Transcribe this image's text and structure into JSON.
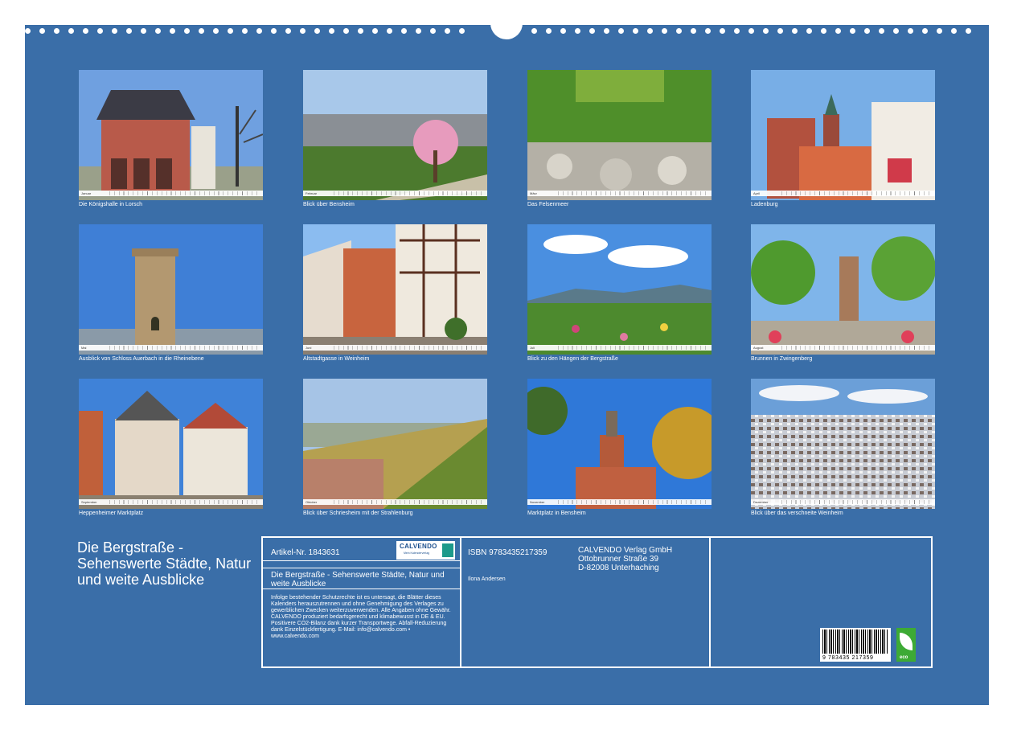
{
  "months": [
    {
      "month": "Januar",
      "caption": "Die Königshalle in Lorsch",
      "scene": "royal-hall-photo"
    },
    {
      "month": "Februar",
      "caption": "Blick über Bensheim",
      "scene": "town-view-blossom-photo"
    },
    {
      "month": "März",
      "caption": "Das Felsenmeer",
      "scene": "rock-sea-forest-photo"
    },
    {
      "month": "April",
      "caption": "Ladenburg",
      "scene": "church-towers-town-photo"
    },
    {
      "month": "Mai",
      "caption": "Ausblick von Schloss Auerbach in die Rheinebene",
      "scene": "stone-tower-photo"
    },
    {
      "month": "Juni",
      "caption": "Altstadtgasse in Weinheim",
      "scene": "half-timbered-lane-photo"
    },
    {
      "month": "Juli",
      "caption": "Blick zu den Hängen der Bergstraße",
      "scene": "meadow-hills-photo"
    },
    {
      "month": "August",
      "caption": "Brunnen in Zwingenberg",
      "scene": "fountain-square-photo"
    },
    {
      "month": "September",
      "caption": "Heppenheimer Marktplatz",
      "scene": "market-square-photo"
    },
    {
      "month": "Oktober",
      "caption": "Blick über Schriesheim mit der Strahlenburg",
      "scene": "vineyard-slope-photo"
    },
    {
      "month": "November",
      "caption": "Marktplatz in Bensheim",
      "scene": "statue-autumn-photo"
    },
    {
      "month": "Dezember",
      "caption": "Blick über das verschneite Weinheim",
      "scene": "snowy-town-photo"
    }
  ],
  "title": "Die Bergstraße - Sehenswerte Städte, Natur und weite Ausblicke",
  "info": {
    "article": "Artikel-Nr. 1843631",
    "logo": {
      "name": "CALVENDO",
      "slogan": "Mein Kalenderverlag"
    },
    "subtitle": "Die Bergstraße - Sehenswerte Städte, Natur und weite Ausblicke",
    "legal": "Infolge bestehender Schutzrechte ist es untersagt, die Blätter dieses Kalenders herauszutrennen und ohne Genehmigung des Verlages zu gewerblichen Zwecken weiterzuverwenden. Alle Angaben ohne Gewähr. CALVENDO produziert bedarfsgerecht und klimabewusst in DE & EU. Positivere CO2-Bilanz dank kurzer Transportwege. Abfall-Reduzierung dank Einzelstückfertigung. E-Mail: info@calvendo.com • www.calvendo.com",
    "isbn": "ISBN 9783435217359",
    "author": "Ilona Andersen",
    "publisher": [
      "CALVENDO Verlag GmbH",
      "Ottobrunner Straße 39",
      "D-82008 Unterhaching"
    ],
    "barcode_number": "9 783435 217359",
    "eco_label": "eco"
  },
  "colors": {
    "background": "#3a6ea8",
    "text": "#ffffff"
  }
}
